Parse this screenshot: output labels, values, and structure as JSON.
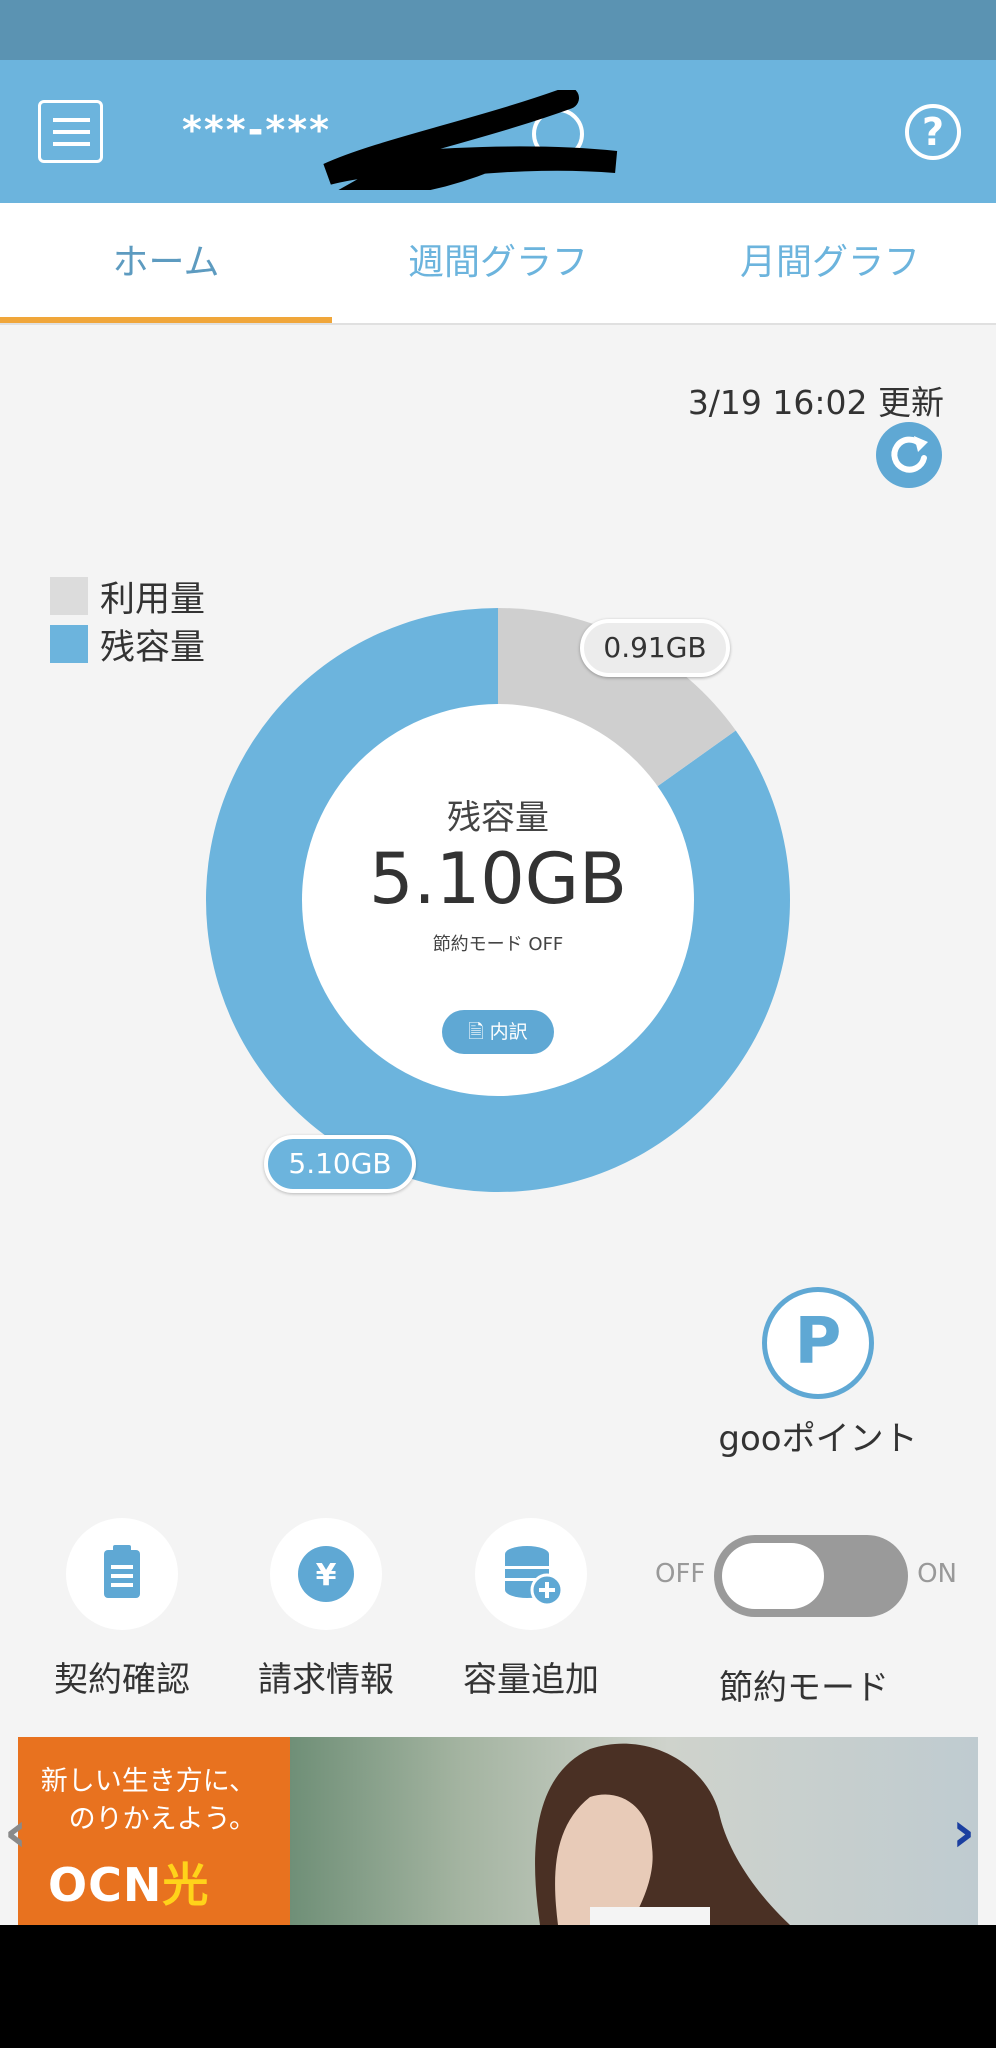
{
  "header": {
    "account_id": "***-***",
    "menu_icon": "hamburger-menu-icon",
    "help_icon": "help-circle-icon",
    "help_glyph": "?"
  },
  "tabs": [
    {
      "label": "ホーム",
      "active": true
    },
    {
      "label": "週間グラフ",
      "active": false
    },
    {
      "label": "月間グラフ",
      "active": false
    }
  ],
  "update": {
    "timestamp": "3/19 16:02 更新",
    "refresh_icon": "refresh-icon"
  },
  "legend": {
    "used_label": "利用量",
    "remaining_label": "残容量"
  },
  "usage": {
    "used_gb": 0.91,
    "remaining_gb": 5.1,
    "used_bubble": "0.91GB",
    "remaining_bubble": "5.10GB",
    "center_label": "残容量",
    "center_value": "5.10GB",
    "saving_mode_status": "節約モード OFF",
    "breakdown_button": "内訳"
  },
  "points": {
    "glyph": "P",
    "label": "gooポイント"
  },
  "actions": [
    {
      "label": "契約確認",
      "icon": "clipboard-icon"
    },
    {
      "label": "請求情報",
      "icon": "yen-icon"
    },
    {
      "label": "容量追加",
      "icon": "database-add-icon"
    }
  ],
  "saving_mode": {
    "off_label": "OFF",
    "on_label": "ON",
    "label": "節約モード",
    "enabled": false
  },
  "banner": {
    "line1": "新しい生き方に、",
    "line2": "のりかえよう。",
    "logo_main": "OCN",
    "logo_accent": "光"
  },
  "colors": {
    "header": "#6cb4dd",
    "status_bar": "#5b93b2",
    "accent_tab": "#f0a63a",
    "remaining": "#6cb4dd",
    "used": "#d0d0d0",
    "banner_orange": "#e8721f"
  }
}
